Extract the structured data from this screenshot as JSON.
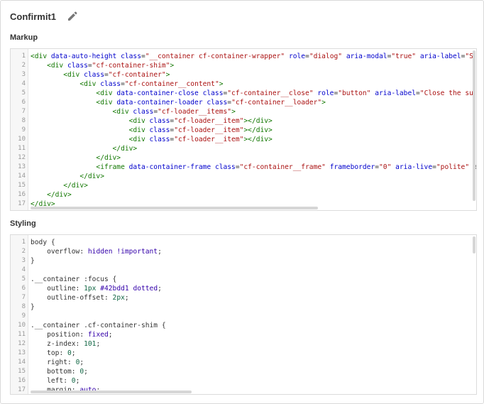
{
  "header": {
    "title": "Confirmit1",
    "edit_icon": "pencil-icon"
  },
  "markup": {
    "label": "Markup",
    "lines": [
      [
        [
          "tag",
          "<div "
        ],
        [
          "attr",
          "data-auto-height "
        ],
        [
          "attr",
          "class"
        ],
        [
          "txt",
          "="
        ],
        [
          "str",
          "\"__container cf-container-wrapper\""
        ],
        [
          "txt",
          " "
        ],
        [
          "attr",
          "role"
        ],
        [
          "txt",
          "="
        ],
        [
          "str",
          "\"dialog\""
        ],
        [
          "txt",
          " "
        ],
        [
          "attr",
          "aria-modal"
        ],
        [
          "txt",
          "="
        ],
        [
          "str",
          "\"true\""
        ],
        [
          "txt",
          " "
        ],
        [
          "attr",
          "aria-label"
        ],
        [
          "txt",
          "="
        ],
        [
          "str",
          "\"S"
        ]
      ],
      [
        [
          "txt",
          "    "
        ],
        [
          "tag",
          "<div "
        ],
        [
          "attr",
          "class"
        ],
        [
          "txt",
          "="
        ],
        [
          "str",
          "\"cf-container-shim\""
        ],
        [
          "tag",
          ">"
        ]
      ],
      [
        [
          "txt",
          "        "
        ],
        [
          "tag",
          "<div "
        ],
        [
          "attr",
          "class"
        ],
        [
          "txt",
          "="
        ],
        [
          "str",
          "\"cf-container\""
        ],
        [
          "tag",
          ">"
        ]
      ],
      [
        [
          "txt",
          "            "
        ],
        [
          "tag",
          "<div "
        ],
        [
          "attr",
          "class"
        ],
        [
          "txt",
          "="
        ],
        [
          "str",
          "\"cf-container__content\""
        ],
        [
          "tag",
          ">"
        ]
      ],
      [
        [
          "txt",
          "                "
        ],
        [
          "tag",
          "<div "
        ],
        [
          "attr",
          "data-container-close "
        ],
        [
          "attr",
          "class"
        ],
        [
          "txt",
          "="
        ],
        [
          "str",
          "\"cf-container__close\""
        ],
        [
          "txt",
          " "
        ],
        [
          "attr",
          "role"
        ],
        [
          "txt",
          "="
        ],
        [
          "str",
          "\"button\""
        ],
        [
          "txt",
          " "
        ],
        [
          "attr",
          "aria-label"
        ],
        [
          "txt",
          "="
        ],
        [
          "str",
          "\"Close the su"
        ]
      ],
      [
        [
          "txt",
          "                "
        ],
        [
          "tag",
          "<div "
        ],
        [
          "attr",
          "data-container-loader "
        ],
        [
          "attr",
          "class"
        ],
        [
          "txt",
          "="
        ],
        [
          "str",
          "\"cf-container__loader\""
        ],
        [
          "tag",
          ">"
        ]
      ],
      [
        [
          "txt",
          "                    "
        ],
        [
          "tag",
          "<div "
        ],
        [
          "attr",
          "class"
        ],
        [
          "txt",
          "="
        ],
        [
          "str",
          "\"cf-loader__items\""
        ],
        [
          "tag",
          ">"
        ]
      ],
      [
        [
          "txt",
          "                        "
        ],
        [
          "tag",
          "<div "
        ],
        [
          "attr",
          "class"
        ],
        [
          "txt",
          "="
        ],
        [
          "str",
          "\"cf-loader__item\""
        ],
        [
          "tag",
          "></div>"
        ]
      ],
      [
        [
          "txt",
          "                        "
        ],
        [
          "tag",
          "<div "
        ],
        [
          "attr",
          "class"
        ],
        [
          "txt",
          "="
        ],
        [
          "str",
          "\"cf-loader__item\""
        ],
        [
          "tag",
          "></div>"
        ]
      ],
      [
        [
          "txt",
          "                        "
        ],
        [
          "tag",
          "<div "
        ],
        [
          "attr",
          "class"
        ],
        [
          "txt",
          "="
        ],
        [
          "str",
          "\"cf-loader__item\""
        ],
        [
          "tag",
          "></div>"
        ]
      ],
      [
        [
          "txt",
          "                    "
        ],
        [
          "tag",
          "</div>"
        ]
      ],
      [
        [
          "txt",
          "                "
        ],
        [
          "tag",
          "</div>"
        ]
      ],
      [
        [
          "txt",
          "                "
        ],
        [
          "tag",
          "<iframe "
        ],
        [
          "attr",
          "data-container-frame "
        ],
        [
          "attr",
          "class"
        ],
        [
          "txt",
          "="
        ],
        [
          "str",
          "\"cf-container__frame\""
        ],
        [
          "txt",
          " "
        ],
        [
          "attr",
          "frameborder"
        ],
        [
          "txt",
          "="
        ],
        [
          "str",
          "\"0\""
        ],
        [
          "txt",
          " "
        ],
        [
          "attr",
          "aria-live"
        ],
        [
          "txt",
          "="
        ],
        [
          "str",
          "\"polite\""
        ],
        [
          "txt",
          " a"
        ]
      ],
      [
        [
          "txt",
          "            "
        ],
        [
          "tag",
          "</div>"
        ]
      ],
      [
        [
          "txt",
          "        "
        ],
        [
          "tag",
          "</div>"
        ]
      ],
      [
        [
          "txt",
          "    "
        ],
        [
          "tag",
          "</div>"
        ]
      ],
      [
        [
          "tag",
          "</div>"
        ]
      ]
    ]
  },
  "styling": {
    "label": "Styling",
    "lines": [
      [
        [
          "sel",
          "body {"
        ]
      ],
      [
        [
          "txt",
          "    "
        ],
        [
          "prop",
          "overflow"
        ],
        [
          "txt",
          ": "
        ],
        [
          "kw",
          "hidden"
        ],
        [
          "txt",
          " "
        ],
        [
          "imp",
          "!important"
        ],
        [
          "txt",
          ";"
        ]
      ],
      [
        [
          "sel",
          "}"
        ]
      ],
      [
        [
          "txt",
          ""
        ]
      ],
      [
        [
          "sel",
          ".__container :focus {"
        ]
      ],
      [
        [
          "txt",
          "    "
        ],
        [
          "prop",
          "outline"
        ],
        [
          "txt",
          ": "
        ],
        [
          "num",
          "1px"
        ],
        [
          "txt",
          " "
        ],
        [
          "col",
          "#42bdd1"
        ],
        [
          "txt",
          " "
        ],
        [
          "kw",
          "dotted"
        ],
        [
          "txt",
          ";"
        ]
      ],
      [
        [
          "txt",
          "    "
        ],
        [
          "prop",
          "outline-offset"
        ],
        [
          "txt",
          ": "
        ],
        [
          "num",
          "2px"
        ],
        [
          "txt",
          ";"
        ]
      ],
      [
        [
          "sel",
          "}"
        ]
      ],
      [
        [
          "txt",
          ""
        ]
      ],
      [
        [
          "sel",
          ".__container .cf-container-shim {"
        ]
      ],
      [
        [
          "txt",
          "    "
        ],
        [
          "prop",
          "position"
        ],
        [
          "txt",
          ": "
        ],
        [
          "kw",
          "fixed"
        ],
        [
          "txt",
          ";"
        ]
      ],
      [
        [
          "txt",
          "    "
        ],
        [
          "prop",
          "z-index"
        ],
        [
          "txt",
          ": "
        ],
        [
          "num",
          "101"
        ],
        [
          "txt",
          ";"
        ]
      ],
      [
        [
          "txt",
          "    "
        ],
        [
          "prop",
          "top"
        ],
        [
          "txt",
          ": "
        ],
        [
          "num",
          "0"
        ],
        [
          "txt",
          ";"
        ]
      ],
      [
        [
          "txt",
          "    "
        ],
        [
          "prop",
          "right"
        ],
        [
          "txt",
          ": "
        ],
        [
          "num",
          "0"
        ],
        [
          "txt",
          ";"
        ]
      ],
      [
        [
          "txt",
          "    "
        ],
        [
          "prop",
          "bottom"
        ],
        [
          "txt",
          ": "
        ],
        [
          "num",
          "0"
        ],
        [
          "txt",
          ";"
        ]
      ],
      [
        [
          "txt",
          "    "
        ],
        [
          "prop",
          "left"
        ],
        [
          "txt",
          ": "
        ],
        [
          "num",
          "0"
        ],
        [
          "txt",
          ";"
        ]
      ],
      [
        [
          "txt",
          "    "
        ],
        [
          "prop",
          "margin"
        ],
        [
          "txt",
          ": "
        ],
        [
          "kw",
          "auto"
        ],
        [
          "txt",
          ";"
        ]
      ]
    ]
  }
}
